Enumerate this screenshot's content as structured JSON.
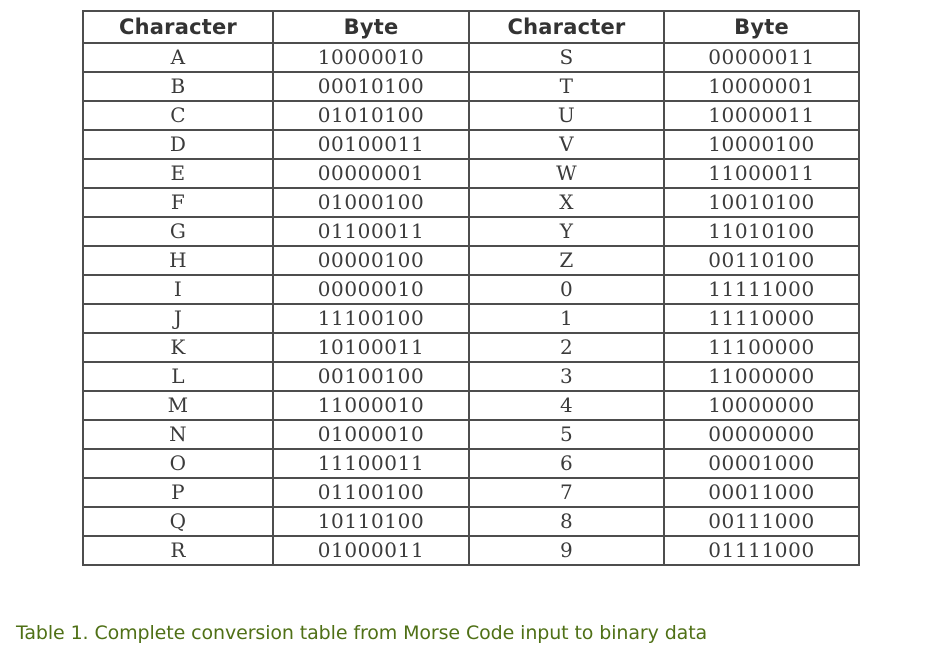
{
  "figure": {
    "caption": "Table 1. Complete conversion table from Morse Code input to binary data",
    "caption_color": "#4f7016",
    "border_color": "#4d4d4d",
    "header_text_color": "#333333",
    "body_text_color": "#3b3b3b",
    "background_color": "#ffffff"
  },
  "table": {
    "headers": [
      "Character",
      "Byte",
      "Character",
      "Byte"
    ],
    "rows": [
      [
        "A",
        "10000010",
        "S",
        "00000011"
      ],
      [
        "B",
        "00010100",
        "T",
        "10000001"
      ],
      [
        "C",
        "01010100",
        "U",
        "10000011"
      ],
      [
        "D",
        "00100011",
        "V",
        "10000100"
      ],
      [
        "E",
        "00000001",
        "W",
        "11000011"
      ],
      [
        "F",
        "01000100",
        "X",
        "10010100"
      ],
      [
        "G",
        "01100011",
        "Y",
        "11010100"
      ],
      [
        "H",
        "00000100",
        "Z",
        "00110100"
      ],
      [
        "I",
        "00000010",
        "0",
        "11111000"
      ],
      [
        "J",
        "11100100",
        "1",
        "11110000"
      ],
      [
        "K",
        "10100011",
        "2",
        "11100000"
      ],
      [
        "L",
        "00100100",
        "3",
        "11000000"
      ],
      [
        "M",
        "11000010",
        "4",
        "10000000"
      ],
      [
        "N",
        "01000010",
        "5",
        "00000000"
      ],
      [
        "O",
        "11100011",
        "6",
        "00001000"
      ],
      [
        "P",
        "01100100",
        "7",
        "00011000"
      ],
      [
        "Q",
        "10110100",
        "8",
        "00111000"
      ],
      [
        "R",
        "01000011",
        "9",
        "01111000"
      ]
    ]
  }
}
